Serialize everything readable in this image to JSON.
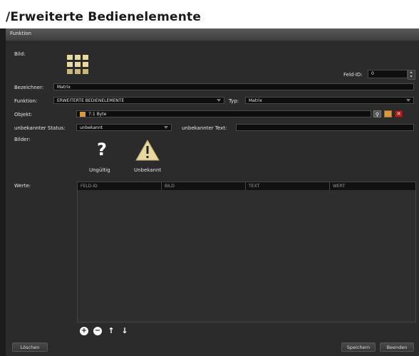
{
  "title": "/Erweiterte Bedienelemente",
  "section": "Funktion",
  "labels": {
    "bild": "Bild:",
    "feld_id": "Feld-ID:",
    "bezeichner": "Bezeichner:",
    "funktion": "Funktion:",
    "typ": "Typ:",
    "objekt": "Objekt:",
    "unbekannter_status": "unbekannter Status:",
    "unbekannter_text": "unbekannter Text:",
    "bilder": "Bilder:",
    "werte": "Werte:"
  },
  "values": {
    "feld_id": "0",
    "bezeichner": "Matrix",
    "funktion": "ERWEITERTE BEDIENELEMENTE",
    "typ": "Matrix",
    "objekt": "7:1 Byte",
    "unbekannter_status": "unbekannt",
    "unbekannter_text": ""
  },
  "images": [
    {
      "label": "Ungültig",
      "icon": "question-icon"
    },
    {
      "label": "Unbekannt",
      "icon": "warning-icon"
    }
  ],
  "table": {
    "columns": [
      "FELD-ID",
      "BILD",
      "TEXT",
      "WERT"
    ]
  },
  "buttons": {
    "loeschen": "Löschen",
    "speichern": "Speichern",
    "beenden": "Beenden"
  },
  "colors": {
    "background": "#2b2b2b",
    "field": "#0e0e0e",
    "warning": "#e8d9a0"
  }
}
